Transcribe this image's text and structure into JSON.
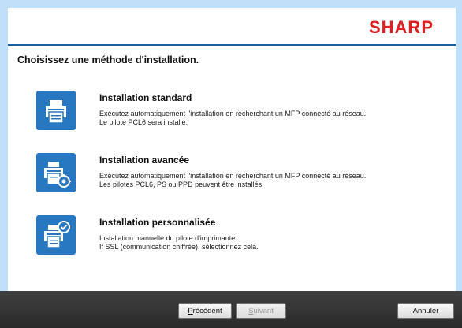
{
  "brand": {
    "logo_text": "SHARP",
    "logo_color": "#e02020"
  },
  "page": {
    "title": "Choisissez une méthode d'installation."
  },
  "options": [
    {
      "title": "Installation standard",
      "desc_lines": [
        "Exécutez automatiquement l'installation en recherchant un MFP connecté au réseau.",
        "Le pilote PCL6 sera installé."
      ],
      "icon": "printer-icon"
    },
    {
      "title": "Installation avancée",
      "desc_lines": [
        "Exécutez automatiquement l'installation en recherchant un MFP connecté au réseau.",
        "Les pilotes PCL6, PS ou PPD peuvent être installés."
      ],
      "icon": "printer-gear-icon"
    },
    {
      "title": "Installation personnalisée",
      "desc_lines": [
        "Installation manuelle du pilote d'imprimante.",
        "If SSL (communication chiffrée), sélectionnez cela."
      ],
      "icon": "printer-check-icon"
    }
  ],
  "footer": {
    "previous_label_underlined": "P",
    "previous_label_rest": "récédent",
    "next_label_underlined": "S",
    "next_label_rest": "uivant",
    "next_enabled": false,
    "cancel_label": "Annuler"
  },
  "colors": {
    "accent": "#2778c0",
    "frame": "#bfe0f8",
    "footer": "#333333"
  }
}
